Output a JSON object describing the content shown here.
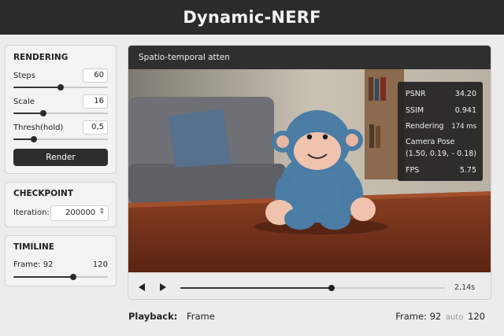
{
  "app": {
    "title": "Dynamic-NERF"
  },
  "rendering": {
    "title": "RENDERING",
    "steps": {
      "label": "Steps",
      "value": "60",
      "level": 0.5
    },
    "scale": {
      "label": "Scale",
      "value": "16",
      "level": 0.32
    },
    "thresh": {
      "label": "Thresh(hold)",
      "value": "0,5",
      "level": 0.22
    },
    "render_label": "Render"
  },
  "checkpoint": {
    "title": "CHECKPOINT",
    "iteration_label": "Iteration:",
    "iteration_value": "200000"
  },
  "timeline": {
    "title": "TIMILINE",
    "frame_label": "Frame: 92",
    "max_label": "120",
    "level": 0.63
  },
  "viewer": {
    "title": "Spatio-temporal atten",
    "stats": {
      "psnr_label": "PSNR",
      "psnr_value": "34.20",
      "ssim_label": "SSIM",
      "ssim_value": "0.941",
      "render_label": "Rendering",
      "render_value": "174 ms",
      "pose_label": "Camera Pose",
      "pose_x": "(1.50, 0.19,",
      "pose_z": "- 0.18)",
      "fps_label": "FPS",
      "fps_value": "5.75"
    },
    "playback_time": "2,14s",
    "playback_level": 0.57
  },
  "status": {
    "playback_key": "Playback:",
    "playback_value": "Frame",
    "frame_key": "Frame:",
    "frame_value": "92",
    "auto_label": "auto",
    "total": "120"
  },
  "colors": {
    "header_bg": "#2b2b2b",
    "panel_bg": "#f3f3f3",
    "accent": "#2d2d2d"
  },
  "icons": [
    "prev-icon",
    "play-icon",
    "chevron-updown-icon"
  ]
}
